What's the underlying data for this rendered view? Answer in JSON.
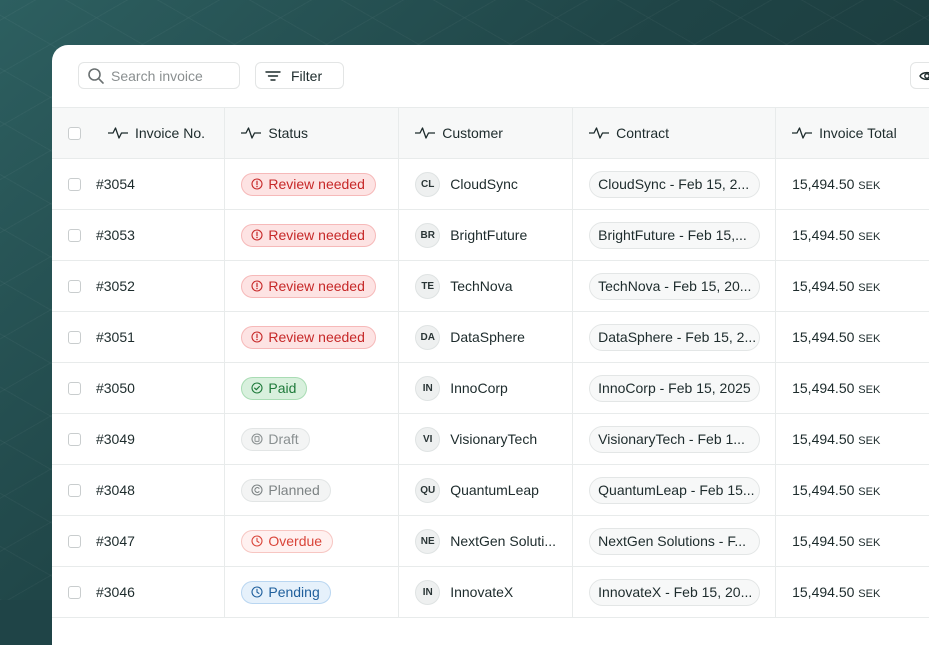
{
  "toolbar": {
    "search_placeholder": "Search invoice",
    "filter_label": "Filter"
  },
  "columns": {
    "invoice_no": "Invoice No.",
    "status": "Status",
    "customer": "Customer",
    "contract": "Contract",
    "invoice_total": "Invoice Total"
  },
  "rows": [
    {
      "invoice": "#3054",
      "status": "Review needed",
      "status_type": "review",
      "initials": "CL",
      "customer": "CloudSync",
      "contract": "CloudSync  - Feb 15, 2...",
      "amount": "15,494.50",
      "currency": "SEK"
    },
    {
      "invoice": "#3053",
      "status": "Review needed",
      "status_type": "review",
      "initials": "BR",
      "customer": "BrightFuture",
      "contract": "BrightFuture - Feb 15,...",
      "amount": "15,494.50",
      "currency": "SEK"
    },
    {
      "invoice": "#3052",
      "status": "Review needed",
      "status_type": "review",
      "initials": "TE",
      "customer": "TechNova",
      "contract": "TechNova - Feb 15, 20...",
      "amount": "15,494.50",
      "currency": "SEK"
    },
    {
      "invoice": "#3051",
      "status": "Review needed",
      "status_type": "review",
      "initials": "DA",
      "customer": "DataSphere",
      "contract": "DataSphere - Feb 15, 2...",
      "amount": "15,494.50",
      "currency": "SEK"
    },
    {
      "invoice": "#3050",
      "status": "Paid",
      "status_type": "paid",
      "initials": "IN",
      "customer": "InnoCorp",
      "contract": "InnoCorp - Feb 15, 2025",
      "amount": "15,494.50",
      "currency": "SEK"
    },
    {
      "invoice": "#3049",
      "status": "Draft",
      "status_type": "draft",
      "initials": "VI",
      "customer": "VisionaryTech",
      "contract": "VisionaryTech  - Feb 1...",
      "amount": "15,494.50",
      "currency": "SEK"
    },
    {
      "invoice": "#3048",
      "status": "Planned",
      "status_type": "planned",
      "initials": "QU",
      "customer": "QuantumLeap",
      "contract": "QuantumLeap - Feb 15...",
      "amount": "15,494.50",
      "currency": "SEK"
    },
    {
      "invoice": "#3047",
      "status": "Overdue",
      "status_type": "overdue",
      "initials": "NE",
      "customer": "NextGen Soluti...",
      "contract": "NextGen Solutions - F...",
      "amount": "15,494.50",
      "currency": "SEK"
    },
    {
      "invoice": "#3046",
      "status": "Pending",
      "status_type": "pending",
      "initials": "IN",
      "customer": "InnovateX",
      "contract": "InnovateX - Feb 15, 20...",
      "amount": "15,494.50",
      "currency": "SEK"
    }
  ],
  "status_styles": {
    "review": {
      "bg": "#fde3e3",
      "border": "#f6b9b9",
      "color": "#c62828",
      "icon": "alert-circle-icon"
    },
    "paid": {
      "bg": "#d8f0dd",
      "border": "#a9dcb4",
      "color": "#1e7a3a",
      "icon": "check-circle-icon"
    },
    "draft": {
      "bg": "#f3f4f4",
      "border": "#e2e5e5",
      "color": "#8a9091",
      "icon": "draft-icon"
    },
    "planned": {
      "bg": "#f3f4f4",
      "border": "#e2e5e5",
      "color": "#7d8384",
      "icon": "planned-icon"
    },
    "overdue": {
      "bg": "#fff1f0",
      "border": "#f7c6c2",
      "color": "#d9453a",
      "icon": "clock-icon"
    },
    "pending": {
      "bg": "#e6f1fb",
      "border": "#b9d6f1",
      "color": "#1f5f9c",
      "icon": "clock-icon"
    }
  }
}
